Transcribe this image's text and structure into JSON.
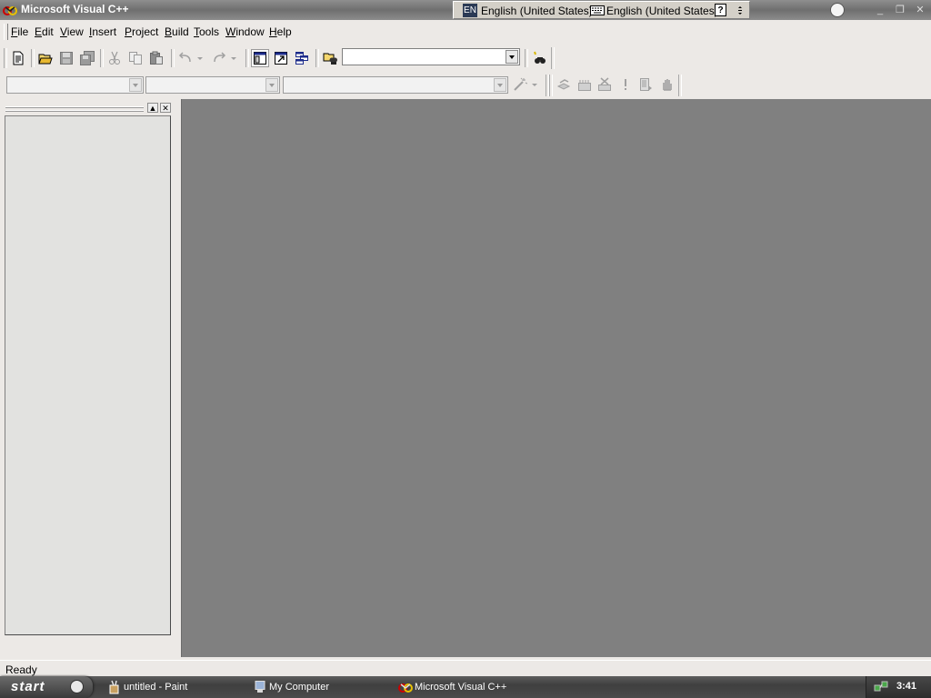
{
  "window": {
    "title": "Microsoft Visual C++",
    "minimize_glyph": "_",
    "restore_glyph": "❐",
    "close_glyph": "✕"
  },
  "language_bar": {
    "lang_code": "EN",
    "language": "English (United States)",
    "keyboard_layout": "English (United States)",
    "help_glyph": "?"
  },
  "menu": {
    "items": [
      {
        "label": "File"
      },
      {
        "label": "Edit"
      },
      {
        "label": "View"
      },
      {
        "label": "Insert"
      },
      {
        "label": "Project"
      },
      {
        "label": "Build"
      },
      {
        "label": "Tools"
      },
      {
        "label": "Window"
      },
      {
        "label": "Help"
      }
    ]
  },
  "standard_toolbar": {
    "icons": [
      "new-text-file-icon",
      "open-icon",
      "save-icon",
      "save-all-icon",
      "cut-icon",
      "copy-icon",
      "paste-icon",
      "undo-icon",
      "redo-icon",
      "workspace-icon",
      "output-icon",
      "window-list-icon",
      "find-in-files-icon",
      "find-icon"
    ],
    "find_combo": {
      "value": ""
    }
  },
  "wizardbar": {
    "class_combo": {
      "value": ""
    },
    "filter_combo": {
      "value": ""
    },
    "members_combo": {
      "value": ""
    },
    "icons": [
      "wizard-action-icon",
      "compile-icon",
      "build-icon",
      "stop-build-icon",
      "execute-icon",
      "go-icon",
      "breakpoint-icon"
    ]
  },
  "workspace": {
    "max_glyph": "▲",
    "close_glyph": "✕"
  },
  "status": {
    "text": "Ready"
  },
  "taskbar": {
    "start_label": "start",
    "tasks": [
      {
        "label": "untitled - Paint",
        "icon": "paint-icon"
      },
      {
        "label": "My Computer",
        "icon": "my-computer-icon"
      },
      {
        "label": "Microsoft Visual C++",
        "icon": "visual-cpp-icon"
      }
    ],
    "clock": "3:41"
  }
}
